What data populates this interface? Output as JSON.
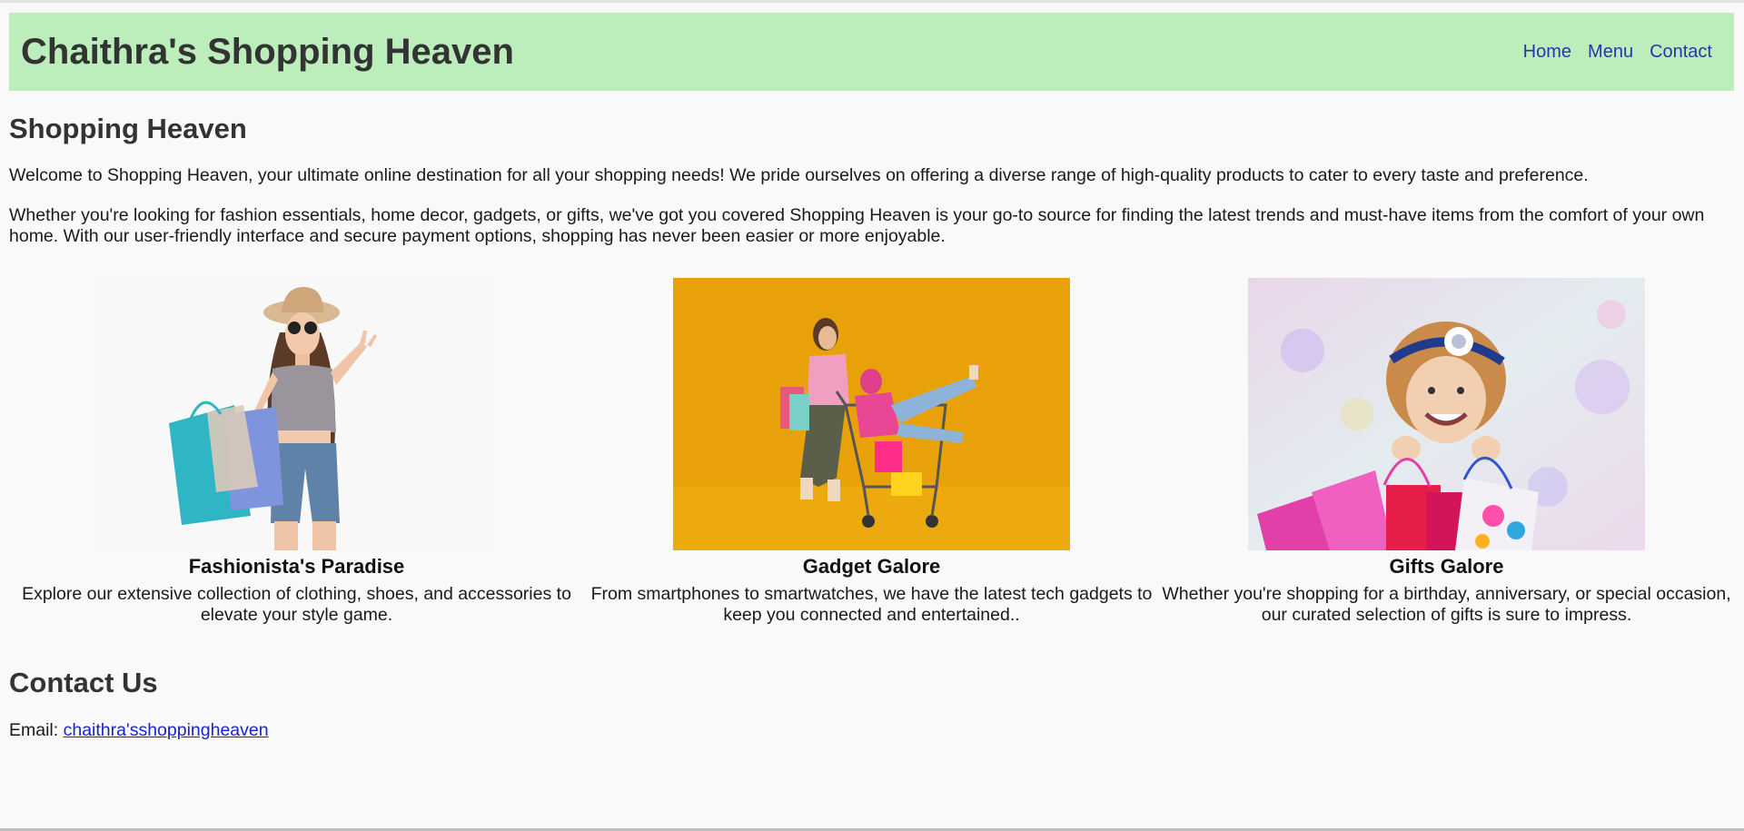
{
  "header": {
    "title": "Chaithra's Shopping Heaven",
    "nav": [
      "Home",
      "Menu",
      "Contact"
    ]
  },
  "intro": {
    "title": "Shopping Heaven",
    "p1": "Welcome to Shopping Heaven, your ultimate online destination for all your shopping needs! We pride ourselves on offering a diverse range of high-quality products to cater to every taste and preference.",
    "p2": "Whether you're looking for fashion essentials, home decor, gadgets, or gifts, we've got you covered Shopping Heaven is your go-to source for finding the latest trends and must-have items from the comfort of your own home. With our user-friendly interface and secure payment options, shopping has never been easier or more enjoyable."
  },
  "cards": [
    {
      "title": "Fashionista's Paradise",
      "text": "Explore our extensive collection of clothing, shoes, and accessories to elevate your style game."
    },
    {
      "title": "Gadget Galore",
      "text": "From smartphones to smartwatches, we have the latest tech gadgets to keep you connected and entertained.."
    },
    {
      "title": "Gifts Galore",
      "text": "Whether you're shopping for a birthday, anniversary, or special occasion, our curated selection of gifts is sure to impress."
    }
  ],
  "contact": {
    "title": "Contact Us",
    "email_label": "Email:",
    "email_link": "chaithra'sshoppingheaven"
  },
  "colors": {
    "header_bg": "#bbeebb",
    "nav_link": "#2a35a8",
    "page_bg": "#f9f9f9",
    "email_link": "#1a25c8"
  }
}
